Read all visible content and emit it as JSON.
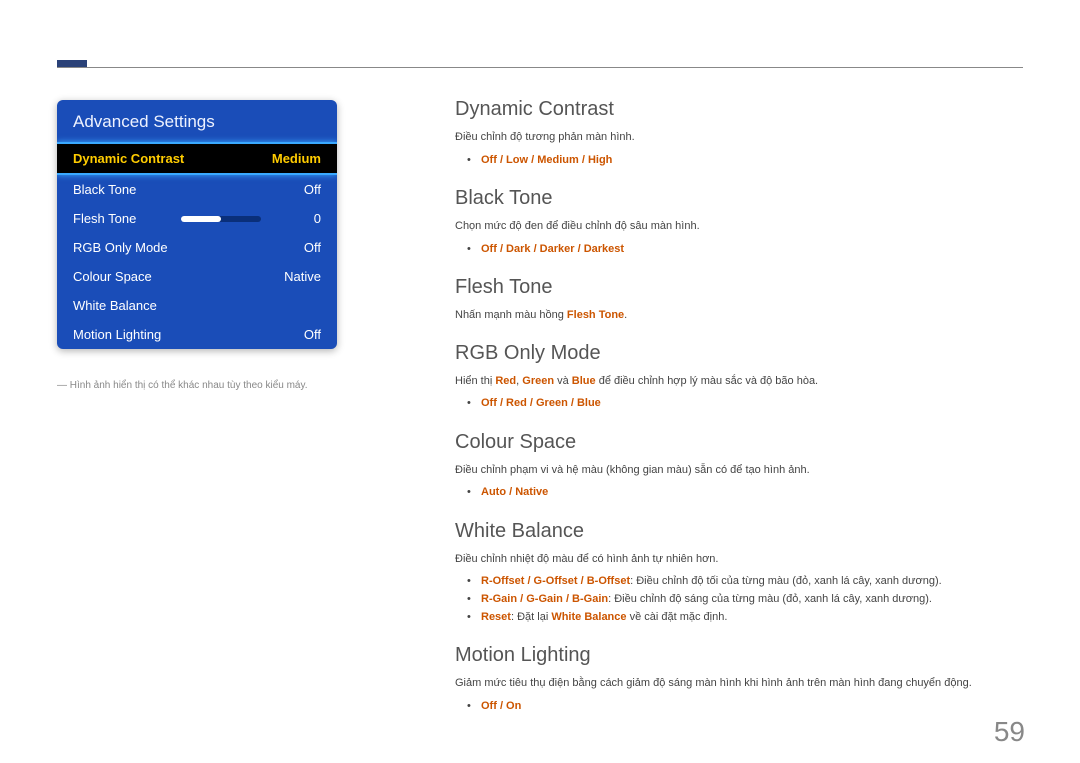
{
  "osd": {
    "title": "Advanced Settings",
    "items": [
      {
        "label": "Dynamic Contrast",
        "value": "Medium",
        "selected": true
      },
      {
        "label": "Black Tone",
        "value": "Off"
      },
      {
        "label": "Flesh Tone",
        "value": "0",
        "slider": true
      },
      {
        "label": "RGB Only Mode",
        "value": "Off"
      },
      {
        "label": "Colour Space",
        "value": "Native"
      },
      {
        "label": "White Balance",
        "value": ""
      },
      {
        "label": "Motion Lighting",
        "value": "Off"
      }
    ],
    "note": "― Hình ảnh hiển thị có thể khác nhau tùy theo kiểu máy."
  },
  "sections": {
    "dynamic_contrast": {
      "title": "Dynamic Contrast",
      "desc": "Điều chỉnh độ tương phản màn hình.",
      "options": "Off / Low / Medium / High"
    },
    "black_tone": {
      "title": "Black Tone",
      "desc": "Chọn mức độ đen để điều chỉnh độ sâu màn hình.",
      "options": "Off / Dark / Darker / Darkest"
    },
    "flesh_tone": {
      "title": "Flesh Tone",
      "desc_pre": "Nhấn mạnh màu hồng ",
      "desc_hl": "Flesh Tone",
      "desc_post": "."
    },
    "rgb_only": {
      "title": "RGB Only Mode",
      "desc_pre": "Hiển thị ",
      "desc_r": "Red",
      "desc_sep1": ", ",
      "desc_g": "Green",
      "desc_sep2": " và ",
      "desc_b": "Blue",
      "desc_post": " để điều chỉnh hợp lý màu sắc và độ bão hòa.",
      "options": "Off / Red / Green / Blue"
    },
    "colour_space": {
      "title": "Colour Space",
      "desc": "Điều chỉnh phạm vi và hệ màu (không gian màu) sẵn có để tạo hình ảnh.",
      "options": "Auto / Native"
    },
    "white_balance": {
      "title": "White Balance",
      "desc": "Điều chỉnh nhiệt độ màu để có hình ảnh tự nhiên hơn.",
      "line1_hl": "R-Offset / G-Offset / B-Offset",
      "line1_txt": ": Điều chỉnh độ tối của từng màu (đỏ, xanh lá cây, xanh dương).",
      "line2_hl": "R-Gain / G-Gain / B-Gain",
      "line2_txt": ": Điều chỉnh độ sáng của từng màu (đỏ, xanh lá cây, xanh dương).",
      "line3_hl1": "Reset",
      "line3_mid": ": Đặt lại ",
      "line3_hl2": "White Balance",
      "line3_txt": " về cài đặt mặc định."
    },
    "motion_lighting": {
      "title": "Motion Lighting",
      "desc": "Giảm mức tiêu thụ điện bằng cách giảm độ sáng màn hình khi hình ảnh trên màn hình đang chuyển động.",
      "options": "Off / On"
    }
  },
  "page_number": "59"
}
